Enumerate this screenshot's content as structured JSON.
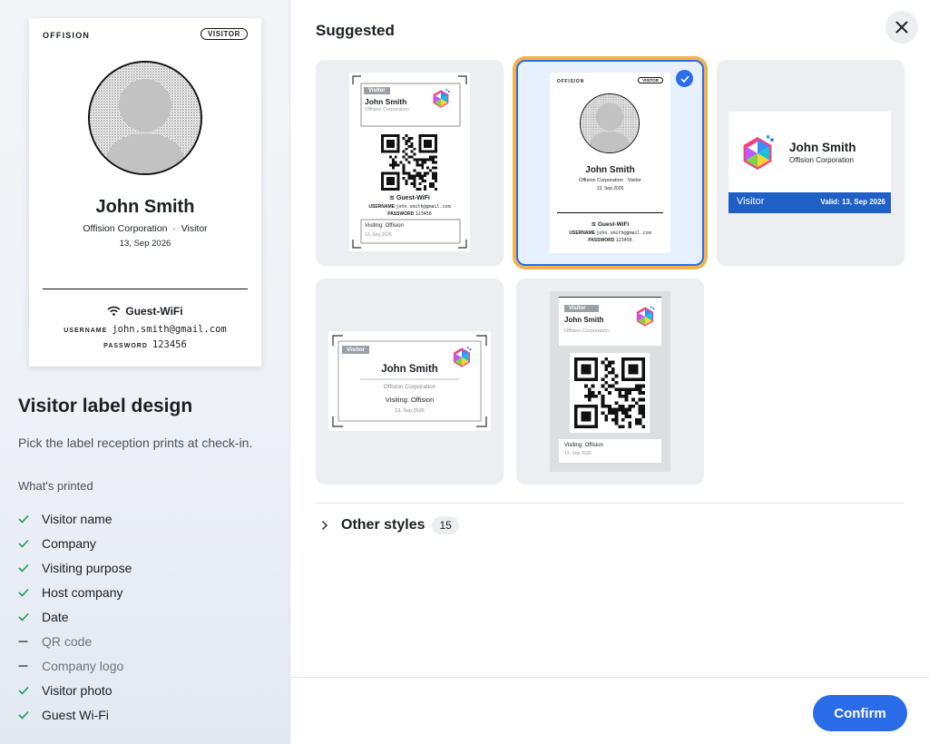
{
  "preview": {
    "brand": "OFFISION",
    "badge": "VISITOR",
    "name": "John Smith",
    "company": "Offision Corporation",
    "role": "Visitor",
    "date": "13, Sep 2026",
    "wifi_label": "Guest-WiFi",
    "username_key": "USERNAME",
    "username": "john.smith@gmail.com",
    "password_key": "PASSWORD",
    "password": "123456"
  },
  "sidebar": {
    "title": "Visitor label design",
    "description": "Pick the label reception prints at check-in.",
    "printed_heading": "What's printed",
    "items": [
      {
        "label": "Visitor name",
        "on": true
      },
      {
        "label": "Company",
        "on": true
      },
      {
        "label": "Visiting purpose",
        "on": true
      },
      {
        "label": "Host company",
        "on": true
      },
      {
        "label": "Date",
        "on": true
      },
      {
        "label": "QR code",
        "on": false
      },
      {
        "label": "Company logo",
        "on": false
      },
      {
        "label": "Visitor photo",
        "on": true
      },
      {
        "label": "Guest Wi-Fi",
        "on": true
      }
    ]
  },
  "main": {
    "suggested_heading": "Suggested",
    "other_label": "Other styles",
    "other_count": "15",
    "confirm_label": "Confirm"
  },
  "thumbs": {
    "t1": {
      "tag": "Visitor",
      "name": "John Smith",
      "company": "Offision Corporation",
      "wifi": "Guest-WiFi",
      "user_key": "USERNAME",
      "user": "john.smith@gmail.com",
      "pass_key": "PASSWORD",
      "pass": "123456",
      "visiting": "Visiting: Offision",
      "date": "13, Sep 2026"
    },
    "t2": {
      "brand": "OFFISION",
      "badge": "VISITOR",
      "name": "John Smith",
      "sub": "Offision Corporation · Visitor",
      "date": "13, Sep 2026",
      "wifi": "Guest-WiFi",
      "user_key": "USERNAME",
      "user": "john.smith@gmail.com",
      "pass_key": "PASSWORD",
      "pass": "123456"
    },
    "t3": {
      "name": "John Smith",
      "company": "Offision Corporation",
      "visitor": "Visitor",
      "valid": "Valid: 13, Sep 2026"
    },
    "t4": {
      "tag": "Visitor",
      "name": "John Smith",
      "company": "Offision Corporation",
      "visiting": "Visiting: Offision",
      "date": "13, Sep 2026"
    },
    "t5": {
      "tag": "Visitor",
      "name": "John Smith",
      "company": "Offision Corporation",
      "visiting": "Visiting: Offision",
      "date": "13, Sep 2026"
    }
  },
  "colors": {
    "accent": "#2b6dea",
    "selection_outline": "#f4b24f",
    "check": "#1a9e5a",
    "banner": "#1f5fc6"
  },
  "icons": {
    "close": "close-icon",
    "check": "check-icon",
    "dash": "dash-icon",
    "wifi": "wifi-icon",
    "chevron": "chevron-right-icon",
    "logo": "hexagon-logo-icon"
  }
}
